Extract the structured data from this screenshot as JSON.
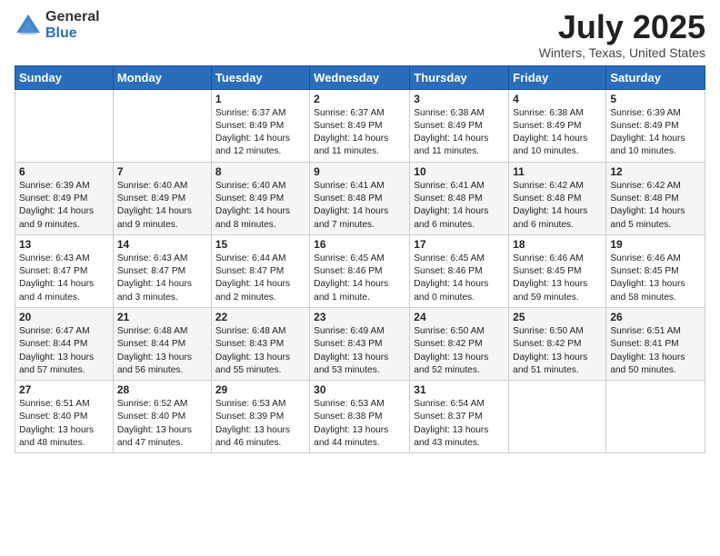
{
  "logo": {
    "general": "General",
    "blue": "Blue"
  },
  "title": "July 2025",
  "subtitle": "Winters, Texas, United States",
  "days_of_week": [
    "Sunday",
    "Monday",
    "Tuesday",
    "Wednesday",
    "Thursday",
    "Friday",
    "Saturday"
  ],
  "weeks": [
    [
      {
        "day": "",
        "info": ""
      },
      {
        "day": "",
        "info": ""
      },
      {
        "day": "1",
        "info": "Sunrise: 6:37 AM\nSunset: 8:49 PM\nDaylight: 14 hours and 12 minutes."
      },
      {
        "day": "2",
        "info": "Sunrise: 6:37 AM\nSunset: 8:49 PM\nDaylight: 14 hours and 11 minutes."
      },
      {
        "day": "3",
        "info": "Sunrise: 6:38 AM\nSunset: 8:49 PM\nDaylight: 14 hours and 11 minutes."
      },
      {
        "day": "4",
        "info": "Sunrise: 6:38 AM\nSunset: 8:49 PM\nDaylight: 14 hours and 10 minutes."
      },
      {
        "day": "5",
        "info": "Sunrise: 6:39 AM\nSunset: 8:49 PM\nDaylight: 14 hours and 10 minutes."
      }
    ],
    [
      {
        "day": "6",
        "info": "Sunrise: 6:39 AM\nSunset: 8:49 PM\nDaylight: 14 hours and 9 minutes."
      },
      {
        "day": "7",
        "info": "Sunrise: 6:40 AM\nSunset: 8:49 PM\nDaylight: 14 hours and 9 minutes."
      },
      {
        "day": "8",
        "info": "Sunrise: 6:40 AM\nSunset: 8:49 PM\nDaylight: 14 hours and 8 minutes."
      },
      {
        "day": "9",
        "info": "Sunrise: 6:41 AM\nSunset: 8:48 PM\nDaylight: 14 hours and 7 minutes."
      },
      {
        "day": "10",
        "info": "Sunrise: 6:41 AM\nSunset: 8:48 PM\nDaylight: 14 hours and 6 minutes."
      },
      {
        "day": "11",
        "info": "Sunrise: 6:42 AM\nSunset: 8:48 PM\nDaylight: 14 hours and 6 minutes."
      },
      {
        "day": "12",
        "info": "Sunrise: 6:42 AM\nSunset: 8:48 PM\nDaylight: 14 hours and 5 minutes."
      }
    ],
    [
      {
        "day": "13",
        "info": "Sunrise: 6:43 AM\nSunset: 8:47 PM\nDaylight: 14 hours and 4 minutes."
      },
      {
        "day": "14",
        "info": "Sunrise: 6:43 AM\nSunset: 8:47 PM\nDaylight: 14 hours and 3 minutes."
      },
      {
        "day": "15",
        "info": "Sunrise: 6:44 AM\nSunset: 8:47 PM\nDaylight: 14 hours and 2 minutes."
      },
      {
        "day": "16",
        "info": "Sunrise: 6:45 AM\nSunset: 8:46 PM\nDaylight: 14 hours and 1 minute."
      },
      {
        "day": "17",
        "info": "Sunrise: 6:45 AM\nSunset: 8:46 PM\nDaylight: 14 hours and 0 minutes."
      },
      {
        "day": "18",
        "info": "Sunrise: 6:46 AM\nSunset: 8:45 PM\nDaylight: 13 hours and 59 minutes."
      },
      {
        "day": "19",
        "info": "Sunrise: 6:46 AM\nSunset: 8:45 PM\nDaylight: 13 hours and 58 minutes."
      }
    ],
    [
      {
        "day": "20",
        "info": "Sunrise: 6:47 AM\nSunset: 8:44 PM\nDaylight: 13 hours and 57 minutes."
      },
      {
        "day": "21",
        "info": "Sunrise: 6:48 AM\nSunset: 8:44 PM\nDaylight: 13 hours and 56 minutes."
      },
      {
        "day": "22",
        "info": "Sunrise: 6:48 AM\nSunset: 8:43 PM\nDaylight: 13 hours and 55 minutes."
      },
      {
        "day": "23",
        "info": "Sunrise: 6:49 AM\nSunset: 8:43 PM\nDaylight: 13 hours and 53 minutes."
      },
      {
        "day": "24",
        "info": "Sunrise: 6:50 AM\nSunset: 8:42 PM\nDaylight: 13 hours and 52 minutes."
      },
      {
        "day": "25",
        "info": "Sunrise: 6:50 AM\nSunset: 8:42 PM\nDaylight: 13 hours and 51 minutes."
      },
      {
        "day": "26",
        "info": "Sunrise: 6:51 AM\nSunset: 8:41 PM\nDaylight: 13 hours and 50 minutes."
      }
    ],
    [
      {
        "day": "27",
        "info": "Sunrise: 6:51 AM\nSunset: 8:40 PM\nDaylight: 13 hours and 48 minutes."
      },
      {
        "day": "28",
        "info": "Sunrise: 6:52 AM\nSunset: 8:40 PM\nDaylight: 13 hours and 47 minutes."
      },
      {
        "day": "29",
        "info": "Sunrise: 6:53 AM\nSunset: 8:39 PM\nDaylight: 13 hours and 46 minutes."
      },
      {
        "day": "30",
        "info": "Sunrise: 6:53 AM\nSunset: 8:38 PM\nDaylight: 13 hours and 44 minutes."
      },
      {
        "day": "31",
        "info": "Sunrise: 6:54 AM\nSunset: 8:37 PM\nDaylight: 13 hours and 43 minutes."
      },
      {
        "day": "",
        "info": ""
      },
      {
        "day": "",
        "info": ""
      }
    ]
  ]
}
